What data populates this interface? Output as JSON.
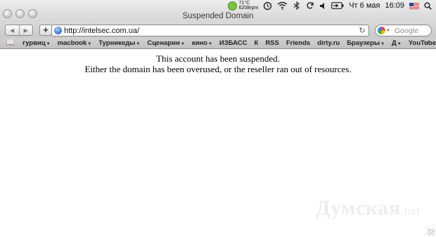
{
  "window": {
    "title": "Suspended Domain"
  },
  "menubar": {
    "temp": "71°C",
    "fan": "6208rpm",
    "day": "Чт 6 мая",
    "time": "16:09"
  },
  "toolbar": {
    "url": "http://intelsec.com.ua/",
    "search_placeholder": "Google"
  },
  "bookmarks": [
    {
      "label": "гурвиц",
      "menu": true
    },
    {
      "label": "macbook",
      "menu": true
    },
    {
      "label": "Турникеды",
      "menu": true
    },
    {
      "label": "Сценарии",
      "menu": true
    },
    {
      "label": "кино",
      "menu": true
    },
    {
      "label": "ИЗБАСС",
      "menu": false
    },
    {
      "label": "К",
      "menu": false
    },
    {
      "label": "RSS",
      "menu": false
    },
    {
      "label": "Friends",
      "menu": false
    },
    {
      "label": "dirty.ru",
      "menu": false
    },
    {
      "label": "Браузеры",
      "menu": true
    },
    {
      "label": "Д",
      "menu": true
    },
    {
      "label": "YouTube",
      "menu": false
    }
  ],
  "page": {
    "line1": "This account has been suspended.",
    "line2": "Either the domain has been overused, or the reseller ran out of resources."
  },
  "watermark": {
    "main": "Думская",
    "suffix": ".net"
  }
}
